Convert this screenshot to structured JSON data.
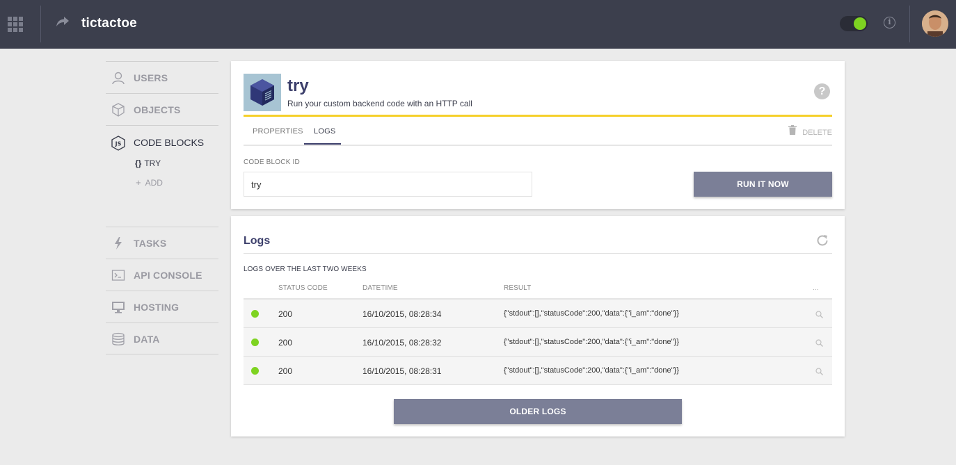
{
  "header": {
    "app_title": "tictactoe",
    "apps_icon": "grid-icon",
    "share_icon": "share-arrow-icon",
    "toggle_state": "on",
    "info_icon": "info-icon",
    "accent": "#7ed321"
  },
  "sidebar": {
    "items": [
      {
        "label": "USERS",
        "icon": "user-icon"
      },
      {
        "label": "OBJECTS",
        "icon": "cube-icon"
      },
      {
        "label": "CODE BLOCKS",
        "icon": "nodejs-icon",
        "active": true
      },
      {
        "label": "TASKS",
        "icon": "bolt-icon"
      },
      {
        "label": "API CONSOLE",
        "icon": "terminal-icon"
      },
      {
        "label": "HOSTING",
        "icon": "monitor-icon"
      },
      {
        "label": "DATA",
        "icon": "database-icon"
      }
    ],
    "code_blocks": {
      "try_label": "TRY",
      "try_prefix": "{}",
      "add_label": "ADD",
      "add_prefix": "+"
    }
  },
  "code_block": {
    "title": "try",
    "description": "Run your custom backend code with an HTTP call",
    "tabs": [
      "PROPERTIES",
      "LOGS"
    ],
    "active_tab": "LOGS",
    "delete_label": "DELETE",
    "id_label": "CODE BLOCK ID",
    "id_value": "try",
    "run_button": "RUN IT NOW",
    "help_glyph": "?"
  },
  "logs": {
    "title": "Logs",
    "subtitle": "LOGS OVER THE LAST TWO WEEKS",
    "columns": {
      "status": "STATUS CODE",
      "datetime": "DATETIME",
      "result": "RESULT",
      "more": "..."
    },
    "rows": [
      {
        "status": "200",
        "datetime": "16/10/2015, 08:28:34",
        "result": "{\"stdout\":[],\"statusCode\":200,\"data\":{\"i_am\":\"done\"}}"
      },
      {
        "status": "200",
        "datetime": "16/10/2015, 08:28:32",
        "result": "{\"stdout\":[],\"statusCode\":200,\"data\":{\"i_am\":\"done\"}}"
      },
      {
        "status": "200",
        "datetime": "16/10/2015, 08:28:31",
        "result": "{\"stdout\":[],\"statusCode\":200,\"data\":{\"i_am\":\"done\"}}"
      }
    ],
    "older_button": "OLDER LOGS"
  }
}
